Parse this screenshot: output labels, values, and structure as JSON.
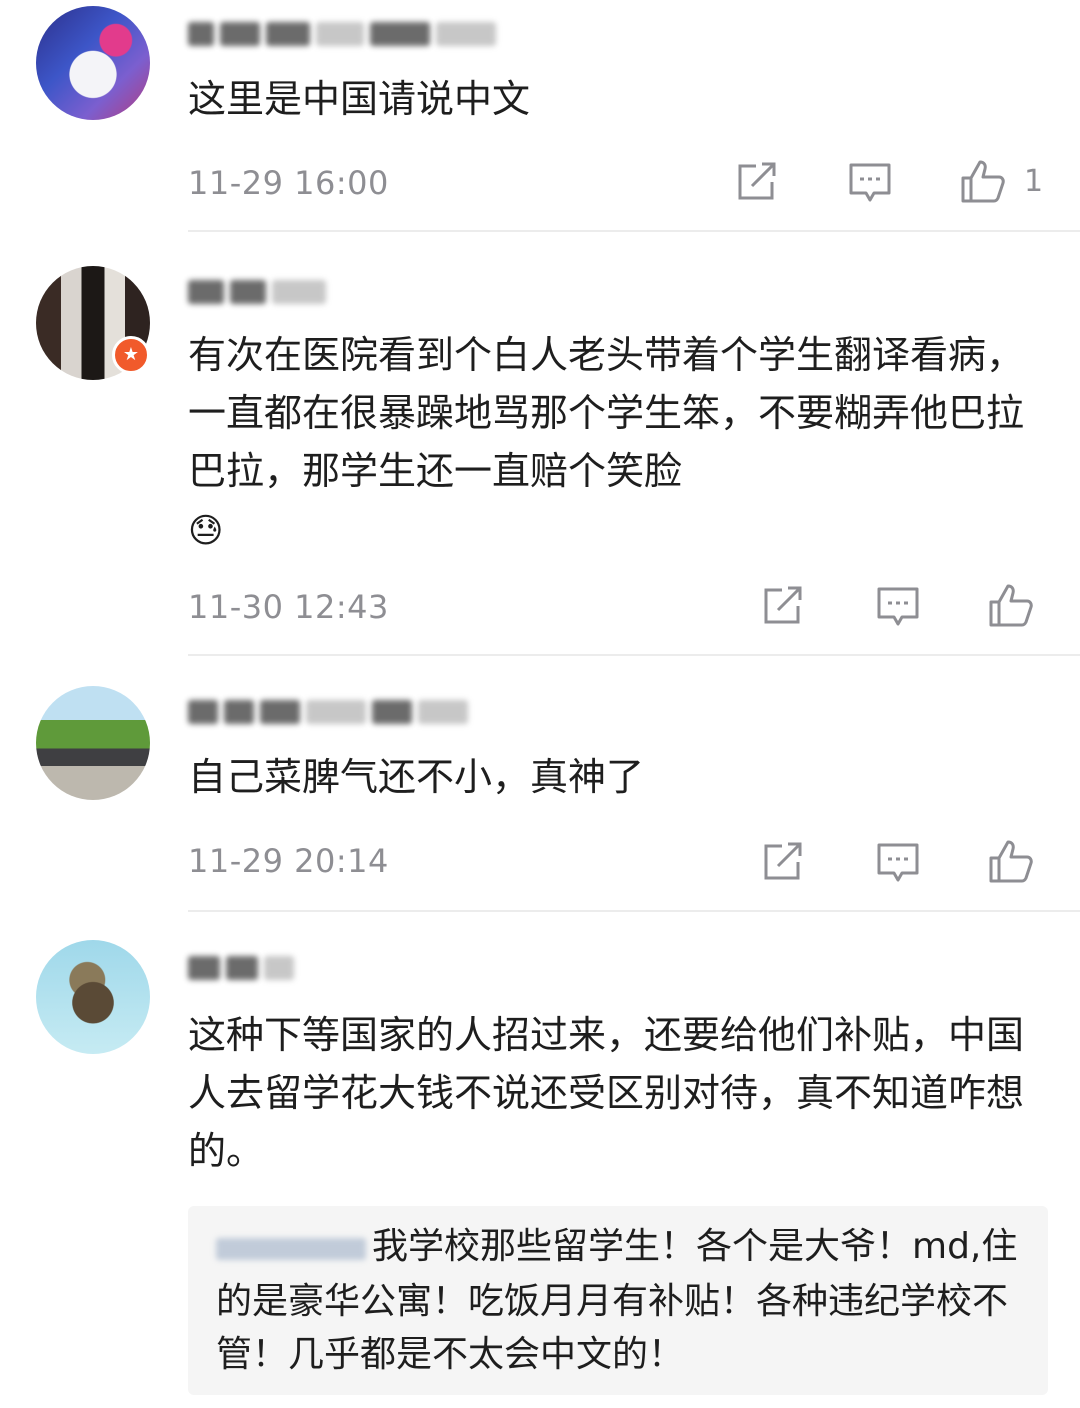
{
  "comments": [
    {
      "username": "",
      "text": "这里是中国请说中文",
      "time": "11-29 16:00",
      "like_count": "1",
      "avatar_icon": "avatar-pixelated"
    },
    {
      "username": "",
      "text": "有次在医院看到个白人老头带着个学生翻译看病，一直都在很暴躁地骂那个学生笨，不要糊弄他巴拉巴拉，那学生还一直赔个笑脸",
      "emoji": "😓",
      "time": "11-30 12:43",
      "like_count": "",
      "avatar_icon": "avatar-pixelated",
      "badge_icon": "star-badge-icon"
    },
    {
      "username": "",
      "text": "自己菜脾气还不小，真神了",
      "time": "11-29 20:14",
      "like_count": "",
      "avatar_icon": "avatar-car-landscape"
    },
    {
      "username": "",
      "text": "这种下等国家的人招过来，还要给他们补贴，中国人去留学花大钱不说还受区别对待，真不知道咋想的。",
      "time": "",
      "like_count": "",
      "avatar_icon": "avatar-pixelated",
      "reply": {
        "author": "",
        "text": "我学校那些留学生！各个是大爷！md,住的是豪华公寓！吃饭月月有补贴！各种违纪学校不管！几乎都是不太会中文的！"
      }
    }
  ],
  "icons": {
    "repost": "repost-icon",
    "comment": "comment-icon",
    "like": "thumbs-up-icon"
  },
  "colors": {
    "text": "#1e1e1e",
    "meta": "#8e8e93",
    "divider": "#ececec",
    "reply_bg": "#f5f5f5",
    "badge": "#f15a2b"
  }
}
